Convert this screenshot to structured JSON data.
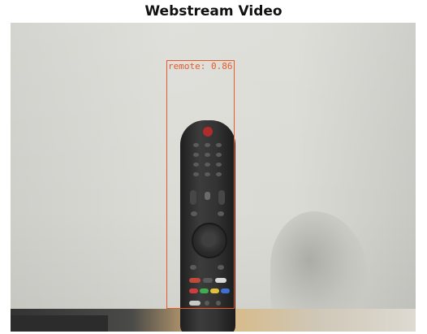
{
  "window": {
    "title": "Webstream Video"
  },
  "video": {
    "detection": {
      "label_text": "remote: 0.86",
      "class": "remote",
      "confidence": 0.86,
      "color": "#e8582a"
    }
  }
}
